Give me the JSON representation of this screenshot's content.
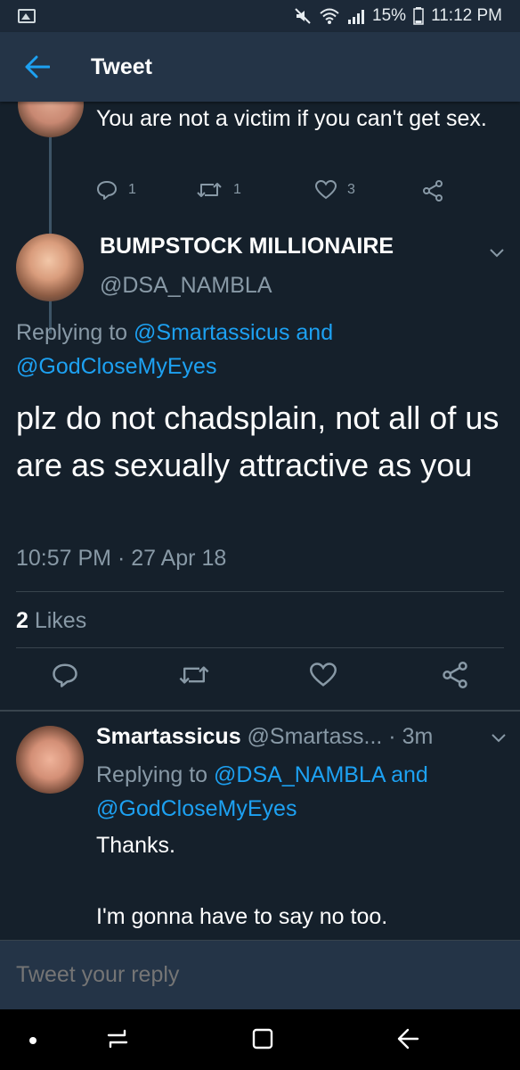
{
  "status_bar": {
    "battery": "15%",
    "time": "11:12 PM"
  },
  "header": {
    "title": "Tweet"
  },
  "parent_tweet": {
    "text": "You are not a victim if you can't get sex.",
    "replies": "1",
    "retweets": "1",
    "likes": "3"
  },
  "main_tweet": {
    "display_name": "BUMPSTOCK MILLIONAIRE",
    "handle": "@DSA_NAMBLA",
    "replying_prefix": "Replying to ",
    "replying_user1": "@Smartassicus",
    "replying_and": " and",
    "replying_user2": "@GodCloseMyEyes",
    "text": "plz do not chadsplain, not all of us are as sexually attractive as you",
    "timestamp": "10:57 PM · 27 Apr 18",
    "likes_count": "2",
    "likes_label": " Likes"
  },
  "reply_tweet": {
    "display_name": "Smartassicus",
    "handle_time": " @Smartass... · 3m",
    "replying_prefix": "Replying to ",
    "replying_user1": "@DSA_NAMBLA",
    "replying_and": " and",
    "replying_user2": "@GodCloseMyEyes",
    "text_line1": "Thanks.",
    "text_line2": "I'm gonna have to say no too."
  },
  "compose": {
    "placeholder": "Tweet your reply"
  },
  "colors": {
    "background": "#15202b",
    "app_bar": "#243447",
    "accent": "#1da1f2",
    "secondary_text": "#8899a6"
  }
}
